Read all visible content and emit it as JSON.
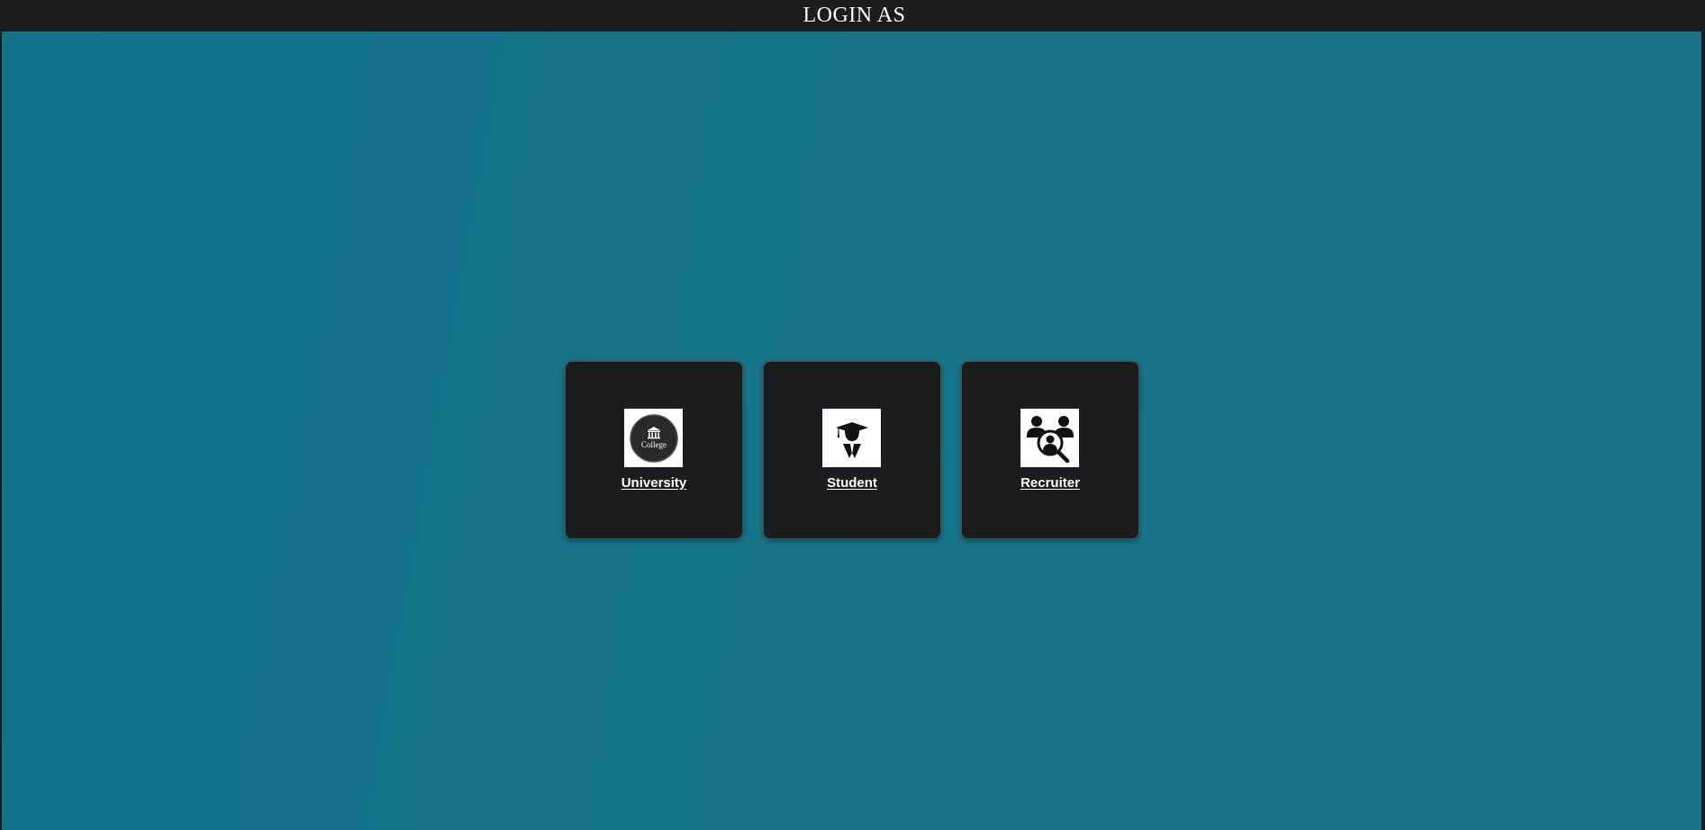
{
  "header": {
    "title": "LOGIN AS"
  },
  "colors": {
    "header_bg": "#1b1c1e",
    "main_bg": "#177489",
    "card_bg": "#1b1c1e",
    "text": "#ffffff"
  },
  "login_options": [
    {
      "label": "University",
      "icon": "college-icon",
      "icon_text": "College"
    },
    {
      "label": "Student",
      "icon": "graduate-icon"
    },
    {
      "label": "Recruiter",
      "icon": "recruiter-search-icon"
    }
  ]
}
